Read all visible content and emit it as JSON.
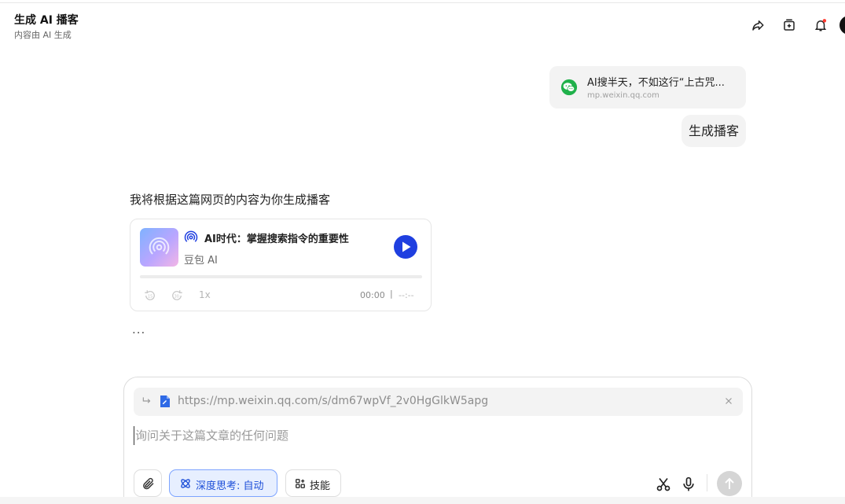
{
  "header": {
    "title": "生成 AI 播客",
    "subtitle": "内容由 AI 生成",
    "icons": [
      "share-icon",
      "new-chat-icon",
      "bell-icon"
    ],
    "notification_dot_color": "#ff3b30"
  },
  "conversation": {
    "link_card": {
      "title": "AI搜半天，不如这行“上古咒...",
      "url": "mp.weixin.qq.com",
      "icon": "wechat-icon",
      "icon_color": "#20b14b"
    },
    "user_message": "生成播客",
    "assistant_message": "我将根据这篇网页的内容为你生成播客",
    "podcast": {
      "title": "AI时代：掌握搜索指令的重要性",
      "author": "豆包 AI",
      "speed": "1x",
      "current_time": "00:00",
      "separator": "|",
      "total_time": "--:--",
      "progress": 0,
      "accent_color": "#1f3fe0"
    },
    "loading_indicator": "..."
  },
  "composer": {
    "attached_url": "https://mp.weixin.qq.com/s/dm67wpVf_2v0HgGlkW5apg",
    "placeholder": "询问关于这篇文章的任何问题",
    "input_value": "",
    "deep_think_label": "深度思考: 自动",
    "skills_label": "技能",
    "accent_color": "#1d4fd8"
  }
}
